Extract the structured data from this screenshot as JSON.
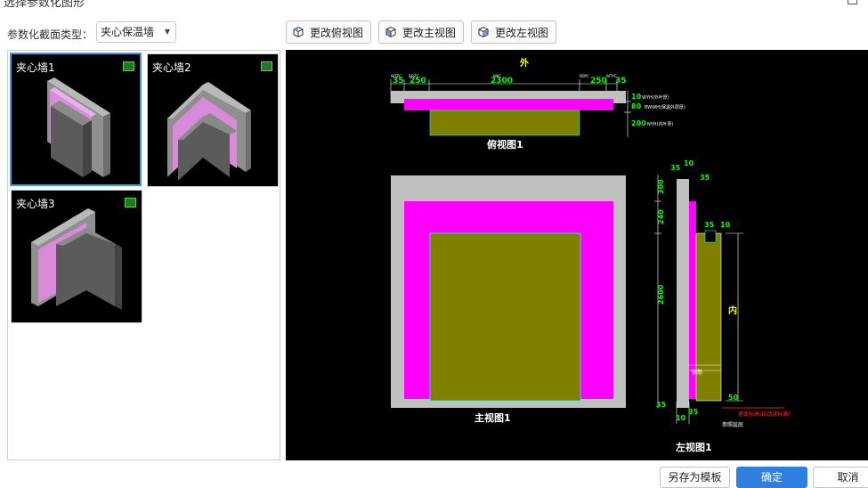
{
  "window": {
    "title": "选择参数化图形"
  },
  "section_type": {
    "label": "参数化截面类型：",
    "value": "夹心保温墙"
  },
  "toolbar": {
    "top_view": "更改俯视图",
    "front_view": "更改主视图",
    "left_view": "更改左视图"
  },
  "thumbnails": [
    {
      "name": "夹心墙1"
    },
    {
      "name": "夹心墙2"
    },
    {
      "name": "夹心墙3"
    }
  ],
  "preview": {
    "outside_label": "外",
    "inside_label": "内",
    "top_view_title": "俯视图1",
    "front_view_title": "主视图1",
    "left_view_title": "左视图1",
    "dims_top": [
      "35",
      "250",
      "2300",
      "250",
      "35"
    ],
    "dims_top_tags": [
      "WTZC",
      "DBZC",
      "WKC",
      "DBYC",
      "WTYC"
    ],
    "dims_right_top": [
      "10",
      "80",
      "200"
    ],
    "dims_right_top_tags": [
      "WYH(外叶厚)",
      "BWWH(保温外层厚)",
      "NYH(内叶厚)"
    ],
    "left_dims_top": [
      "35",
      "10",
      "35"
    ],
    "left_dims_small": [
      "35",
      "10"
    ],
    "left_dims_side": [
      "300",
      "240",
      "2600"
    ],
    "left_dims_bottom": [
      "50",
      "35",
      "10",
      "35"
    ],
    "left_label_mid": "钢筋",
    "left_note": "墙体标高(自动读标高)",
    "left_note2": "参照层底"
  },
  "footer": {
    "save_template": "另存为模板",
    "ok": "确定",
    "cancel": "取消"
  },
  "colors": {
    "accent": "#2f7fe0",
    "selection": "#3d9be9",
    "wythe": "#c0c0c0",
    "insulation": "#ff00ff",
    "inner": "#808000",
    "dimension": "#00ff00"
  }
}
